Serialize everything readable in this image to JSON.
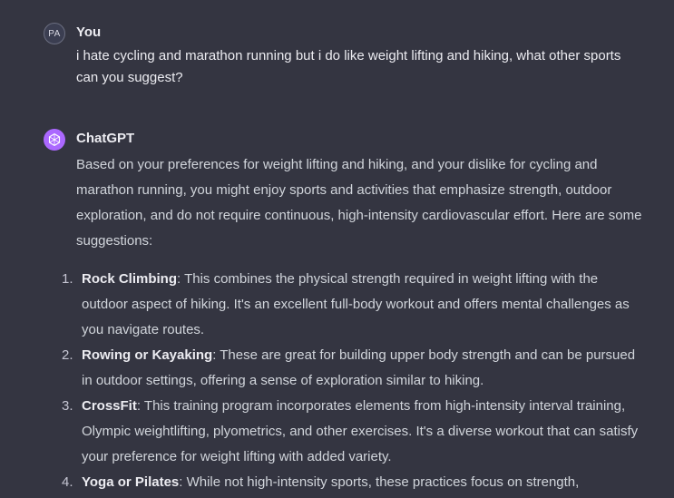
{
  "user_message": {
    "avatar_initials": "PA",
    "author": "You",
    "text": "i hate cycling and marathon running but i do like weight lifting and hiking, what other sports can you suggest?"
  },
  "assistant_message": {
    "avatar_icon": "openai-logo-icon",
    "author": "ChatGPT",
    "intro": "Based on your preferences for weight lifting and hiking, and your dislike for cycling and marathon running, you might enjoy sports and activities that emphasize strength, outdoor exploration, and do not require continuous, high-intensity cardiovascular effort. Here are some suggestions:",
    "suggestions": [
      {
        "number": "1.",
        "title": "Rock Climbing",
        "text": ": This combines the physical strength required in weight lifting with the outdoor aspect of hiking. It's an excellent full-body workout and offers mental challenges as you navigate routes."
      },
      {
        "number": "2.",
        "title": "Rowing or Kayaking",
        "text": ": These are great for building upper body strength and can be pursued in outdoor settings, offering a sense of exploration similar to hiking."
      },
      {
        "number": "3.",
        "title": "CrossFit",
        "text": ": This training program incorporates elements from high-intensity interval training, Olympic weightlifting, plyometrics, and other exercises. It's a diverse workout that can satisfy your preference for weight lifting with added variety."
      },
      {
        "number": "4.",
        "title": "Yoga or Pilates",
        "text": ": While not high-intensity sports, these practices focus on strength,"
      }
    ]
  },
  "colors": {
    "background": "#343541",
    "text": "#ececf1",
    "gpt_avatar": "#ab68ff"
  }
}
